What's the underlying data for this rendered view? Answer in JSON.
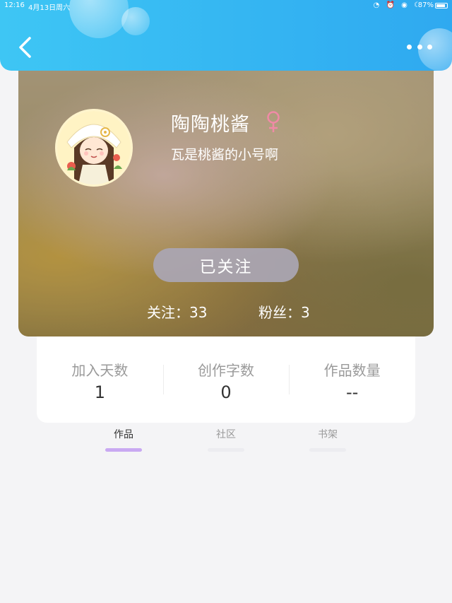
{
  "status_bar": {
    "time": "12:16",
    "date": "4月13日周六",
    "battery": "87%"
  },
  "header": {
    "background_color": "#34b4f2",
    "back_icon": "chevron-left-icon",
    "more_icon": "more-dots-icon"
  },
  "profile": {
    "nickname": "陶陶桃酱",
    "gender_icon": "female-symbol-icon",
    "gender_color": "#f08aa6",
    "bio": "瓦是桃酱的小号啊",
    "follow_button_label": "已关注",
    "following_text": "关注：33",
    "followers_text": "粉丝：3"
  },
  "stats": [
    {
      "label": "加入天数",
      "value": "1"
    },
    {
      "label": "创作字数",
      "value": "0"
    },
    {
      "label": "作品数量",
      "value": "--"
    }
  ],
  "tabs": [
    {
      "label": "作品",
      "active": true
    },
    {
      "label": "社区",
      "active": false
    },
    {
      "label": "书架",
      "active": false
    }
  ],
  "colors": {
    "tab_active_underline": "#c9a9f2",
    "page_background": "#f4f4f6"
  }
}
